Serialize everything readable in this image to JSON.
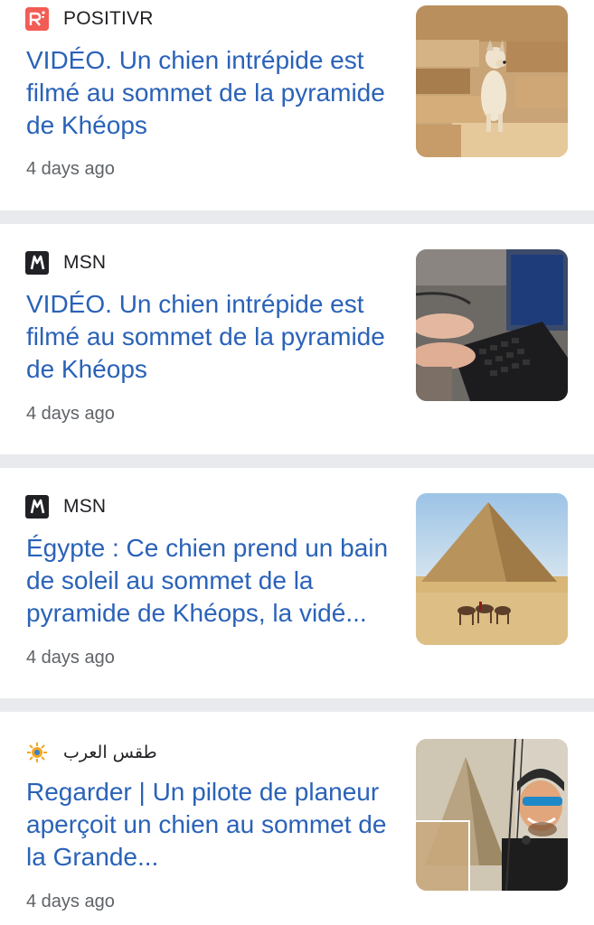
{
  "feed": {
    "items": [
      {
        "source": "POSITIVR",
        "source_icon": "positivr-logo-icon",
        "headline": "VIDÉO. Un chien intrépide est filmé au sommet de la pyramide de Khéops",
        "time": "4 days ago",
        "thumbnail": "dog-on-pyramid-stones-image"
      },
      {
        "source": "MSN",
        "source_icon": "msn-logo-icon",
        "headline": "VIDÉO. Un chien intrépide est filmé au sommet de la pyramide de Khéops",
        "time": "4 days ago",
        "thumbnail": "hands-on-laptop-image"
      },
      {
        "source": "MSN",
        "source_icon": "msn-logo-icon",
        "headline": "Égypte : Ce chien prend un bain de soleil au sommet de la pyramide de Khéops, la vidé...",
        "time": "4 days ago",
        "thumbnail": "pyramid-with-camels-image"
      },
      {
        "source": "طقس العرب",
        "source_icon": "arabia-weather-logo-icon",
        "headline": "Regarder | Un pilote de planeur aperçoit un chien au sommet de la Grande...",
        "time": "4 days ago",
        "thumbnail": "paraglider-pilot-pyramid-image"
      }
    ]
  },
  "colors": {
    "headline": "#2a62b8",
    "divider": "#e8eaed",
    "meta_text": "#5f6368",
    "positivr_brand": "#f25c54"
  }
}
